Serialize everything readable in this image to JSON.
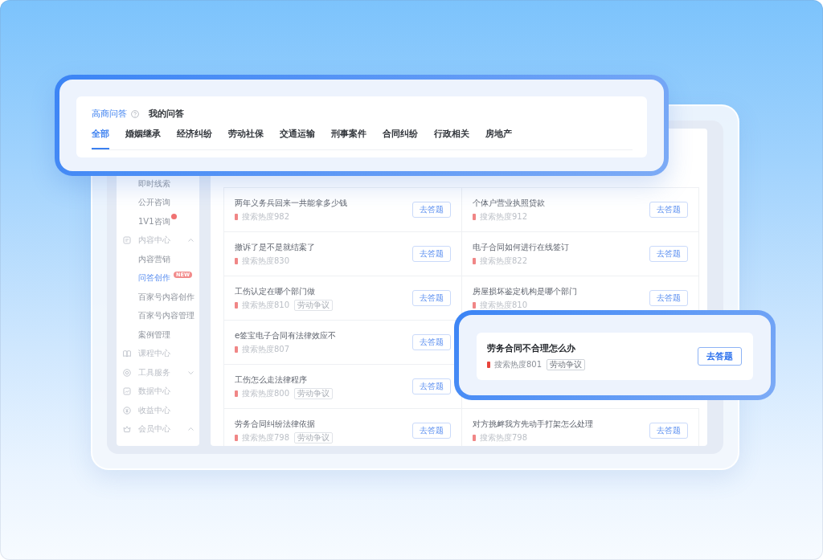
{
  "app_window": {
    "sidebar": {
      "items": [
        {
          "kind": "item",
          "label": "即时线索",
          "selected": false,
          "notification": false
        },
        {
          "kind": "item",
          "label": "公开咨询",
          "selected": false,
          "notification": false
        },
        {
          "kind": "item",
          "label": "1V1咨询",
          "selected": false,
          "notification": true
        },
        {
          "kind": "section",
          "label": "内容中心",
          "expanded": true,
          "children": [
            {
              "label": "内容营销",
              "selected": false
            },
            {
              "label": "问答创作",
              "selected": true,
              "badge": "NEW"
            },
            {
              "label": "百家号内容创作",
              "selected": false
            },
            {
              "label": "百家号内容管理",
              "selected": false
            },
            {
              "label": "案例管理",
              "selected": false
            }
          ]
        },
        {
          "kind": "section",
          "label": "课程中心"
        },
        {
          "kind": "section",
          "label": "工具服务",
          "expanded": false
        },
        {
          "kind": "section",
          "label": "数据中心"
        },
        {
          "kind": "section",
          "label": "收益中心"
        },
        {
          "kind": "section",
          "label": "会员中心",
          "expanded": true
        }
      ]
    },
    "questions": {
      "rows": [
        {
          "left": {
            "title": "两年义务兵回来一共能拿多少钱",
            "heat": "搜索热度982",
            "button": "去答题"
          },
          "right": {
            "title": "个体户营业执照贷款",
            "heat": "搜索热度912",
            "button": "去答题"
          }
        },
        {
          "left": {
            "title": "撤诉了是不是就结案了",
            "heat": "搜索热度830",
            "button": "去答题"
          },
          "right": {
            "title": "电子合同如何进行在线签订",
            "heat": "搜索热度822",
            "button": "去答题"
          }
        },
        {
          "left": {
            "title": "工伤认定在哪个部门做",
            "heat": "搜索热度810",
            "tag": "劳动争议",
            "button": "去答题"
          },
          "right": {
            "title": "房屋损坏鉴定机构是哪个部门",
            "heat": "搜索热度810",
            "button": "去答题"
          }
        },
        {
          "left": {
            "title": "e签宝电子合同有法律效应不",
            "heat": "搜索热度807",
            "button": "去答题"
          }
        },
        {
          "left": {
            "title": "工伤怎么走法律程序",
            "heat": "搜索热度800",
            "tag": "劳动争议",
            "button": "去答题"
          }
        },
        {
          "left": {
            "title": "劳务合同纠纷法律依据",
            "heat": "搜索热度798",
            "tag": "劳动争议",
            "button": "去答题"
          },
          "right": {
            "title": "对方挑衅我方先动手打架怎么处理",
            "heat": "搜索热度798",
            "button": "去答题"
          }
        }
      ]
    }
  },
  "category_panel": {
    "header_tabs": [
      {
        "label": "高商问答",
        "selected": true,
        "help": true
      },
      {
        "label": "我的问答",
        "selected": false,
        "help": false
      }
    ],
    "categories": [
      {
        "label": "全部",
        "selected": true
      },
      {
        "label": "婚姻继承",
        "selected": false
      },
      {
        "label": "经济纠纷",
        "selected": false
      },
      {
        "label": "劳动社保",
        "selected": false
      },
      {
        "label": "交通运输",
        "selected": false
      },
      {
        "label": "刑事案件",
        "selected": false
      },
      {
        "label": "合同纠纷",
        "selected": false
      },
      {
        "label": "行政相关",
        "selected": false
      },
      {
        "label": "房地产",
        "selected": false
      }
    ]
  },
  "highlight_card": {
    "title": "劳务合同不合理怎么办",
    "heat": "搜索热度801",
    "tag": "劳动争议",
    "button": "去答题"
  }
}
